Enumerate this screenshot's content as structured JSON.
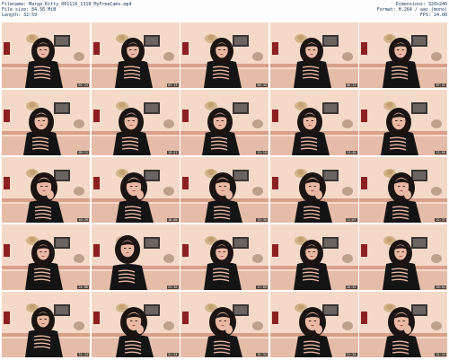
{
  "header": {
    "left": [
      "Filename: Marga_Kitty_061116_1318_MyFreeCams.mp4",
      "File size: 84.56 MiB",
      "Length: 32:59"
    ],
    "right": [
      "Dimensions: 320x240",
      "Format: H.264 / aac (mono)",
      "FPS: 24.00"
    ]
  },
  "thumbnails": [
    {
      "time": "01:24",
      "pose": "sit"
    },
    {
      "time": "03:13",
      "pose": "sit"
    },
    {
      "time": "04:43",
      "pose": "sit"
    },
    {
      "time": "06:12",
      "pose": "sit"
    },
    {
      "time": "07:42",
      "pose": "sit"
    },
    {
      "time": "09:11",
      "pose": "lean"
    },
    {
      "time": "10:41",
      "pose": "lean"
    },
    {
      "time": "12:10",
      "pose": "lean"
    },
    {
      "time": "13:40",
      "pose": "lean"
    },
    {
      "time": "15:09",
      "pose": "lean"
    },
    {
      "time": "16:39",
      "pose": "close"
    },
    {
      "time": "18:08",
      "pose": "close"
    },
    {
      "time": "19:38",
      "pose": "close"
    },
    {
      "time": "21:07",
      "pose": "close"
    },
    {
      "time": "22:37",
      "pose": "close"
    },
    {
      "time": "24:06",
      "pose": "sit"
    },
    {
      "time": "25:36",
      "pose": "tilt"
    },
    {
      "time": "27:05",
      "pose": "sit"
    },
    {
      "time": "28:35",
      "pose": "sit"
    },
    {
      "time": "30:04",
      "pose": "sit"
    },
    {
      "time": "31:34",
      "pose": "sit"
    },
    {
      "time": "31:34",
      "pose": "close"
    },
    {
      "time": "31:34",
      "pose": "close"
    },
    {
      "time": "31:34",
      "pose": "close"
    },
    {
      "time": "31:34",
      "pose": "close"
    }
  ],
  "colors": {
    "header_text": "#1a3a60",
    "wall": "#f4d9c8",
    "hair": "#1b1412",
    "skin": "#e9b9a4",
    "top": "#141414"
  }
}
